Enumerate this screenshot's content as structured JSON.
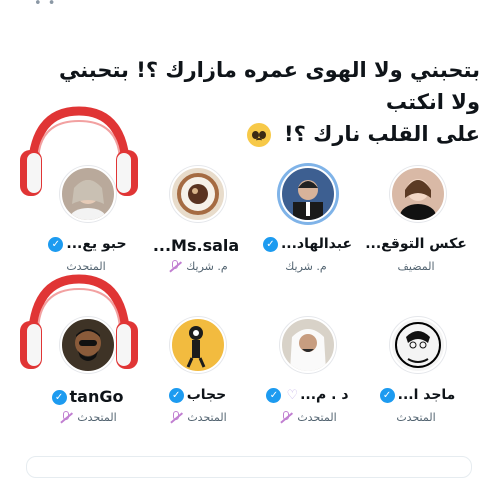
{
  "title_line1": "بتحبني ولا الهوى عمره مازارك ؟! بتحبني ولا انكتب",
  "title_line2": "على القلب نارك ؟!",
  "title_emoji": "pleading-face-emoji",
  "speakers": [
    {
      "name": "عكس التوقع...",
      "role": "المضيف",
      "verified": false,
      "avatar_color": "#d9b9a6"
    },
    {
      "name": "عبدالهاد...",
      "role": "م. شريك",
      "verified": true,
      "avatar_color": "#3d5f91"
    },
    {
      "name": "Ms.sala...",
      "role": "م. شريك",
      "verified": false,
      "muted": true,
      "avatar_color": "#c7a27b"
    },
    {
      "name": "حبو يع...",
      "role": "المتحدث",
      "verified": true,
      "avatar_color": "#b9a99b",
      "headphones": true
    },
    {
      "name": "ماجد ا...",
      "role": "المتحدث",
      "verified": true,
      "avatar_color": "#f4f4f4"
    },
    {
      "name": "د . م...",
      "role": "المتحدث",
      "verified": true,
      "muted": true,
      "avatar_color": "#d8d2c8"
    },
    {
      "name": "حجاب",
      "role": "المتحدث",
      "verified": true,
      "muted": true,
      "avatar_color": "#f2bb3f"
    },
    {
      "name": "tanGo",
      "role": "المتحدث",
      "verified": true,
      "muted": true,
      "avatar_color": "#3e3326",
      "headphones": true
    }
  ]
}
